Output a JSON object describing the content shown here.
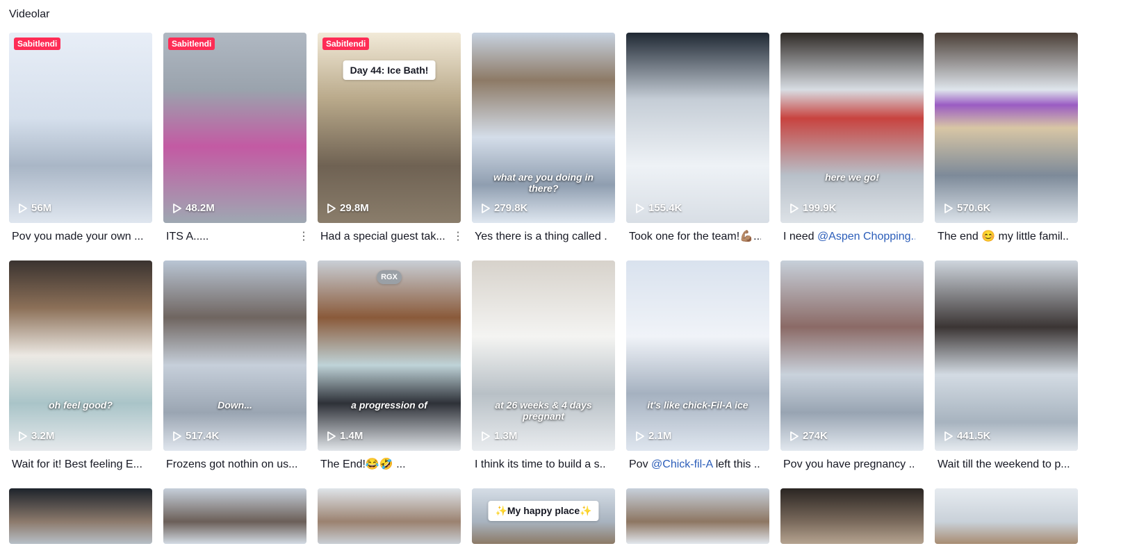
{
  "section": {
    "title": "Videolar"
  },
  "pinned_label": "Sabitlendi",
  "colors": {
    "pinned_badge": "#fe2c55",
    "mention": "#2b5db9"
  },
  "icons": {
    "views": "play-icon",
    "more": "more-vertical-icon"
  },
  "row1": [
    {
      "views": "56M",
      "caption": "Pov you made your own ...",
      "pinned": true,
      "bg": "bg-snow1"
    },
    {
      "views": "48.2M",
      "caption": "ITS A.....",
      "pinned": true,
      "more": true,
      "bg": "bg-snow2"
    },
    {
      "views": "29.8M",
      "caption": "Had a special guest tak...",
      "pinned": true,
      "more": true,
      "bg": "bg-dirt",
      "card_text": "Day 44: Ice Bath!"
    },
    {
      "views": "279.8K",
      "caption": "Yes there is a thing called ...",
      "bg": "bg-forest",
      "overlay": "what are you doing in there?"
    },
    {
      "views": "155.4K",
      "caption": "Took one for the team!💪🏽...",
      "bg": "bg-blue"
    },
    {
      "views": "199.9K",
      "caption_prefix": "I need ",
      "mention": "@Aspen Chopping...",
      "bg": "bg-red",
      "overlay": "here we go!"
    },
    {
      "views": "570.6K",
      "caption": "The end 😊 my little famil...",
      "bg": "bg-purple"
    }
  ],
  "row2": [
    {
      "views": "3.2M",
      "caption": "Wait for it! Best feeling E...",
      "bg": "bg-couple",
      "overlay": "oh feel good?"
    },
    {
      "views": "517.4K",
      "caption": "Frozens got nothin on us...",
      "bg": "bg-zebra",
      "overlay": "Down..."
    },
    {
      "views": "1.4M",
      "caption": "The End!😂🤣 ...",
      "bg": "bg-tiger",
      "overlay": "a progression of",
      "badge": "RGX"
    },
    {
      "views": "1.3M",
      "caption": "I think its time to build a s...",
      "bg": "bg-white",
      "overlay": "at 26 weeks & 4 days pregnant"
    },
    {
      "views": "2.1M",
      "caption_prefix": "Pov ",
      "mention": "@Chick-fil-A",
      "caption_suffix": " left this ...",
      "bg": "bg-tub",
      "overlay": "it's like chick-Fil-A ice"
    },
    {
      "views": "274K",
      "caption": "Pov you have pregnancy ...",
      "bg": "bg-leopard"
    },
    {
      "views": "441.5K",
      "caption": "Wait till the weekend to p...",
      "bg": "bg-black"
    }
  ],
  "row3": [
    {
      "bg": "bg-r3a"
    },
    {
      "bg": "bg-r3b"
    },
    {
      "bg": "bg-r3c"
    },
    {
      "bg": "bg-r3d",
      "card_text": "✨My happy place✨"
    },
    {
      "bg": "bg-r3e"
    },
    {
      "bg": "bg-r3f"
    },
    {
      "bg": "bg-r3g"
    }
  ]
}
